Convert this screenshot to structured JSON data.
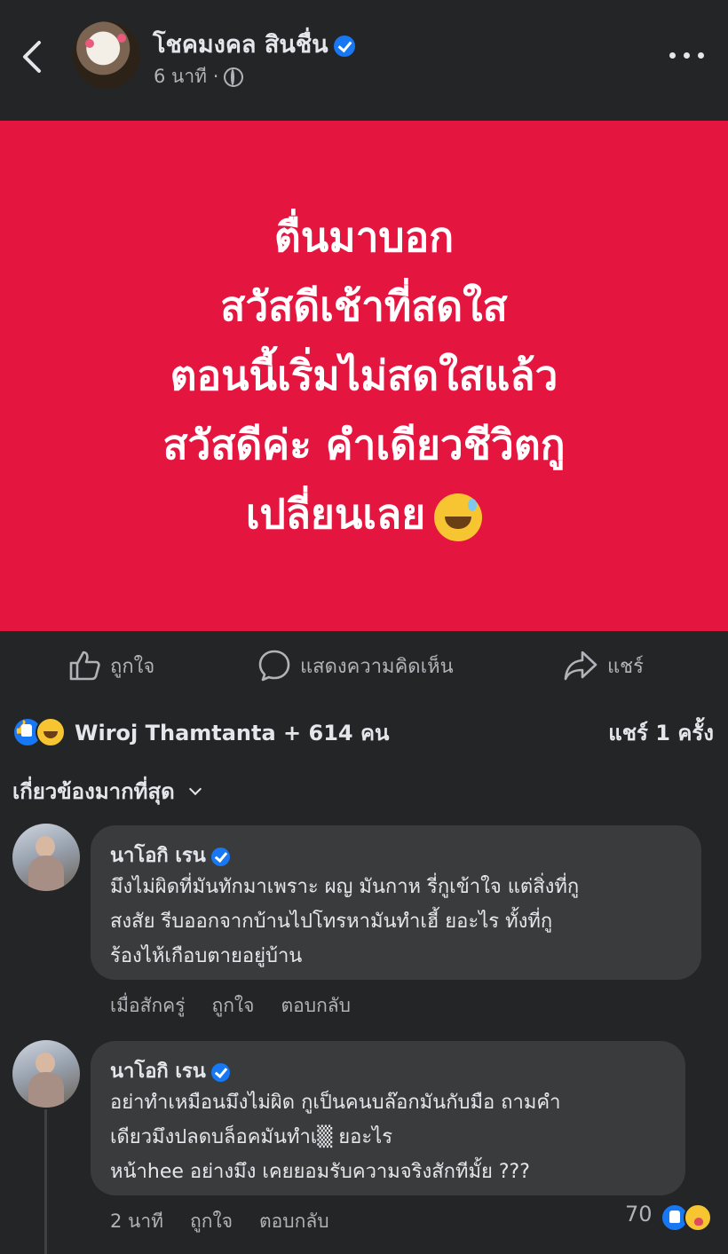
{
  "header": {
    "page_name": "โชคมงคล สินชื่น",
    "time": "6 นาที ·"
  },
  "post": {
    "lines": [
      "ตื่นมาบอก",
      "สวัสดีเช้าที่สดใส",
      "ตอนนี้เริ่มไม่สดใสแล้ว",
      "สวัสดีค่ะ คำเดียวชีวิตกู",
      "เปลี่ยนเลย"
    ],
    "background_color": "#e4153f",
    "emoji": "sweat-smile-emoji"
  },
  "actions": {
    "like_label": "ถูกใจ",
    "comment_label": "แสดงความคิดเห็น",
    "share_label": "แชร์"
  },
  "reactions": {
    "summary": "Wiroj Thamtanta + 614 คน",
    "share_count": "แชร์ 1 ครั้ง"
  },
  "comments_sort": "เกี่ยวข้องมากที่สุด",
  "comments": [
    {
      "author": "นาโอกิ เรน",
      "lines": [
        "มึงไม่ผิดที่มันทักมาเพราะ ผญ มันกาห รี่กูเข้าใจ แต่สิ่งที่กู",
        "สงสัย รีบออกจากบ้านไปโทรหามันทำเฮี้ ยอะไร ทั้งที่กู",
        "ร้องไห้เกือบตายอยู่บ้าน"
      ],
      "time": "เมื่อสักครู่",
      "like": "ถูกใจ",
      "reply": "ตอบกลับ"
    },
    {
      "author": "นาโอกิ เรน",
      "lines": [
        "อย่าทำเหมือนมึงไม่ผิด กูเป็นคนบล๊อกมันกับมือ ถามคำ",
        "เดียวมึงปลดบล็อคมันทำเ▒ ยอะไร",
        "หน้าhee อย่างมึง เคยยอมรับความจริงสักทีมั้ย ???"
      ],
      "time": "2 นาที",
      "like": "ถูกใจ",
      "reply": "ตอบกลับ",
      "reaction_count": "70"
    }
  ],
  "colors": {
    "background": "#242526",
    "bubble": "#3a3b3c",
    "accent": "#1877f2",
    "secondary_text": "#b0b3b8"
  }
}
